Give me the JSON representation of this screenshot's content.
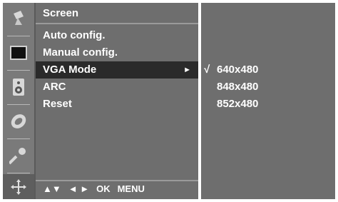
{
  "sidebar": {
    "icons": [
      {
        "name": "satellite-icon"
      },
      {
        "name": "screen-icon",
        "selected": false
      },
      {
        "name": "speaker-icon"
      },
      {
        "name": "clock-icon"
      },
      {
        "name": "key-icon"
      },
      {
        "name": "move-icon"
      }
    ]
  },
  "menu": {
    "title": "Screen",
    "items": [
      {
        "label": "Auto config."
      },
      {
        "label": "Manual config."
      },
      {
        "label": "VGA Mode",
        "arrow": "►"
      },
      {
        "label": "ARC"
      },
      {
        "label": "Reset"
      }
    ],
    "footer": {
      "updown": "▲▼",
      "leftright": "◄ ►",
      "ok": "OK",
      "menu": "MENU"
    }
  },
  "submenu": {
    "items": [
      {
        "label": "640x480",
        "check": "√"
      },
      {
        "label": "848x480",
        "check": ""
      },
      {
        "label": "852x480",
        "check": ""
      }
    ]
  },
  "colors": {
    "panel": "#6e6e6e",
    "selected_row": "#2a2a2a",
    "text": "#ffffff"
  }
}
